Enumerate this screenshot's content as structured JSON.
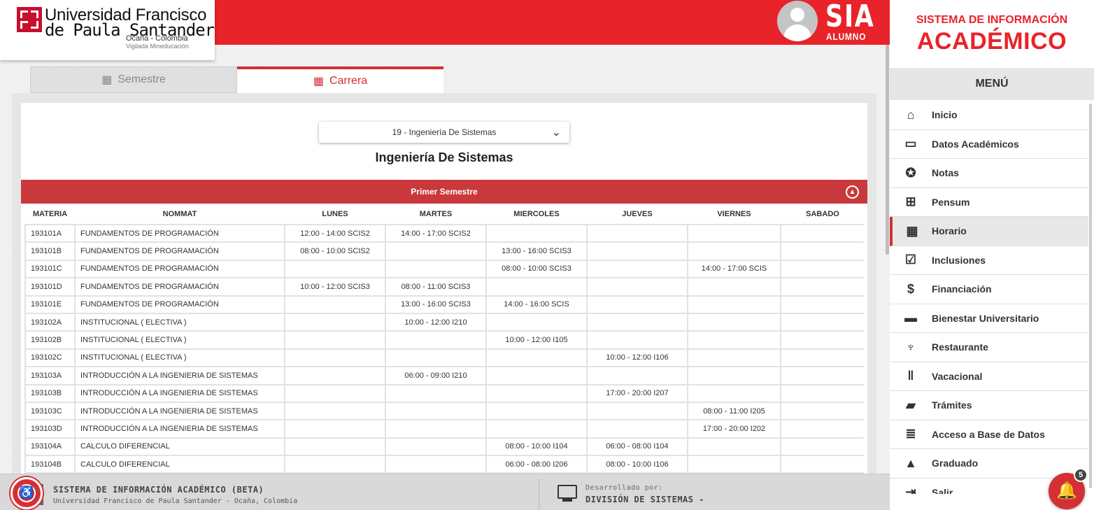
{
  "header": {
    "logo_line1": "Universidad Francisco",
    "logo_line2": "de Paula Santander",
    "logo_line3": "Ocaña - Colombia",
    "logo_line4": "Vigilada Mineducación",
    "app_name": "SIA",
    "role": "ALUMNO",
    "brand_color": "#e8232a"
  },
  "sidebar": {
    "title_small": "SISTEMA DE INFORMACIÓN",
    "title_big": "ACADÉMICO",
    "menu_heading": "MENÚ",
    "items": [
      {
        "label": "Inicio",
        "icon": "home-icon",
        "glyph": "⌂"
      },
      {
        "label": "Datos Académicos",
        "icon": "card-icon",
        "glyph": "▭"
      },
      {
        "label": "Notas",
        "icon": "medal-icon",
        "glyph": "✪"
      },
      {
        "label": "Pensum",
        "icon": "sitemap-icon",
        "glyph": "⊞"
      },
      {
        "label": "Horario",
        "icon": "calendar-icon",
        "glyph": "▦",
        "active": true
      },
      {
        "label": "Inclusiones",
        "icon": "checkbox-icon",
        "glyph": "☑"
      },
      {
        "label": "Financiación",
        "icon": "dollar-icon",
        "glyph": "$"
      },
      {
        "label": "Bienestar Universitario",
        "icon": "briefcase-icon",
        "glyph": "▬"
      },
      {
        "label": "Restaurante",
        "icon": "utensils-icon",
        "glyph": "♆"
      },
      {
        "label": "Vacacional",
        "icon": "books-icon",
        "glyph": "‖"
      },
      {
        "label": "Trámites",
        "icon": "folder-icon",
        "glyph": "▰"
      },
      {
        "label": "Acceso a Base de Datos",
        "icon": "database-icon",
        "glyph": "≣"
      },
      {
        "label": "Graduado",
        "icon": "graduation-cap-icon",
        "glyph": "▲"
      },
      {
        "label": "Salir",
        "icon": "exit-icon",
        "glyph": "⇥"
      }
    ]
  },
  "tabs": [
    {
      "label": "Semestre",
      "icon": "calendar-icon"
    },
    {
      "label": "Carrera",
      "icon": "calendar-icon",
      "active": true
    }
  ],
  "career_select": {
    "value": "19 - Ingeniería De Sistemas"
  },
  "career_title": "Ingeniería De Sistemas",
  "semester": {
    "title": "Primer Semestre",
    "columns": [
      "MATERIA",
      "NOMMAT",
      "LUNES",
      "MARTES",
      "MIERCOLES",
      "JUEVES",
      "VIERNES",
      "SABADO"
    ],
    "rows": [
      [
        "193101A",
        "FUNDAMENTOS DE PROGRAMACIÓN",
        "12:00 - 14:00 SCIS2",
        "14:00 - 17:00 SCIS2",
        "",
        "",
        "",
        ""
      ],
      [
        "193101B",
        "FUNDAMENTOS DE PROGRAMACIÓN",
        "08:00 - 10:00 SCIS2",
        "",
        "13:00 - 16:00 SCIS3",
        "",
        "",
        ""
      ],
      [
        "193101C",
        "FUNDAMENTOS DE PROGRAMACIÓN",
        "",
        "",
        "08:00 - 10:00 SCIS3",
        "",
        "14:00 - 17:00 SCIS",
        ""
      ],
      [
        "193101D",
        "FUNDAMENTOS DE PROGRAMACIÓN",
        "10:00 - 12:00 SCIS3",
        "08:00 - 11:00 SCIS3",
        "",
        "",
        "",
        ""
      ],
      [
        "193101E",
        "FUNDAMENTOS DE PROGRAMACIÓN",
        "",
        "13:00 - 16:00 SCIS3",
        "14:00 - 16:00 SCIS",
        "",
        "",
        ""
      ],
      [
        "193102A",
        "INSTITUCIONAL ( ELECTIVA )",
        "",
        "10:00 - 12:00 I210",
        "",
        "",
        "",
        ""
      ],
      [
        "193102B",
        "INSTITUCIONAL ( ELECTIVA )",
        "",
        "",
        "10:00 - 12:00 I105",
        "",
        "",
        ""
      ],
      [
        "193102C",
        "INSTITUCIONAL ( ELECTIVA )",
        "",
        "",
        "",
        "10:00 - 12:00 I106",
        "",
        ""
      ],
      [
        "193103A",
        "INTRODUCCIÓN A LA INGENIERIA DE SISTEMAS",
        "",
        "06:00 - 09:00 I210",
        "",
        "",
        "",
        ""
      ],
      [
        "193103B",
        "INTRODUCCIÓN A LA INGENIERIA DE SISTEMAS",
        "",
        "",
        "",
        "17:00 - 20:00 I207",
        "",
        ""
      ],
      [
        "193103C",
        "INTRODUCCIÓN A LA INGENIERIA DE SISTEMAS",
        "",
        "",
        "",
        "",
        "08:00 - 11:00 I205",
        ""
      ],
      [
        "193103D",
        "INTRODUCCIÓN A LA INGENIERIA DE SISTEMAS",
        "",
        "",
        "",
        "",
        "17:00 - 20:00 I202",
        ""
      ],
      [
        "193104A",
        "CALCULO DIFERENCIAL",
        "",
        "",
        "08:00 - 10:00 I104",
        "06:00 - 08:00 I104",
        "",
        ""
      ],
      [
        "193104B",
        "CALCULO DIFERENCIAL",
        "",
        "",
        "06:00 - 08:00 I206",
        "08:00 - 10:00 I106",
        "",
        ""
      ]
    ]
  },
  "footer": {
    "title": "SISTEMA DE INFORMACIÓN ACADÉMICO (BETA)",
    "subtitle": "Universidad Francisco de Paula Santander - Ocaña, Colombia",
    "dev_label": "Desarrollado por:",
    "dev_name": "DIVISIÓN DE SISTEMAS -"
  },
  "notifications": {
    "count": "5"
  }
}
